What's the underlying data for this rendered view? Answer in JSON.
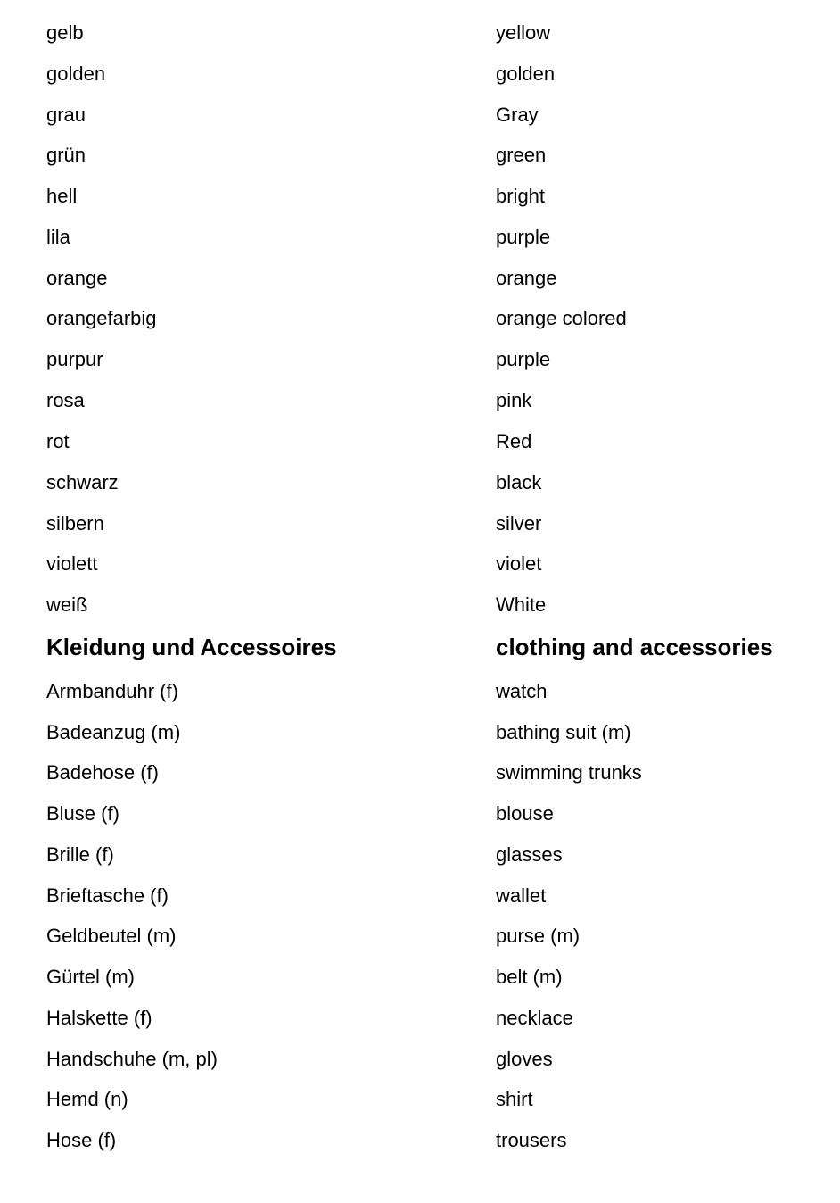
{
  "document": {
    "sections": [
      {
        "heading": null,
        "entries": [
          {
            "de": "gelb",
            "en": "yellow"
          },
          {
            "de": "golden",
            "en": "golden"
          },
          {
            "de": "grau",
            "en": "Gray"
          },
          {
            "de": "grün",
            "en": "green"
          },
          {
            "de": "hell",
            "en": "bright"
          },
          {
            "de": "lila",
            "en": "purple"
          },
          {
            "de": "orange",
            "en": "orange"
          },
          {
            "de": "orangefarbig",
            "en": "orange colored"
          },
          {
            "de": "purpur",
            "en": "purple"
          },
          {
            "de": "rosa",
            "en": "pink"
          },
          {
            "de": "rot",
            "en": "Red"
          },
          {
            "de": "schwarz",
            "en": "black"
          },
          {
            "de": "silbern",
            "en": "silver"
          },
          {
            "de": "violett",
            "en": "violet"
          },
          {
            "de": "weiß",
            "en": "White"
          }
        ]
      },
      {
        "heading": {
          "de": "Kleidung und Accessoires",
          "en": "clothing and accessories"
        },
        "entries": [
          {
            "de": "Armbanduhr (f)",
            "en": "watch"
          },
          {
            "de": "Badeanzug (m)",
            "en": "bathing suit (m)"
          },
          {
            "de": "Badehose (f)",
            "en": "swimming trunks"
          },
          {
            "de": "Bluse (f)",
            "en": "blouse"
          },
          {
            "de": "Brille (f)",
            "en": "glasses"
          },
          {
            "de": "Brieftasche (f)",
            "en": "wallet"
          },
          {
            "de": "Geldbeutel (m)",
            "en": "purse (m)"
          },
          {
            "de": "Gürtel (m)",
            "en": "belt (m)"
          },
          {
            "de": "Halskette (f)",
            "en": "necklace"
          },
          {
            "de": "Handschuhe (m, pl)",
            "en": "gloves"
          },
          {
            "de": "Hemd (n)",
            "en": "shirt"
          },
          {
            "de": "Hose (f)",
            "en": "trousers"
          }
        ]
      }
    ]
  }
}
